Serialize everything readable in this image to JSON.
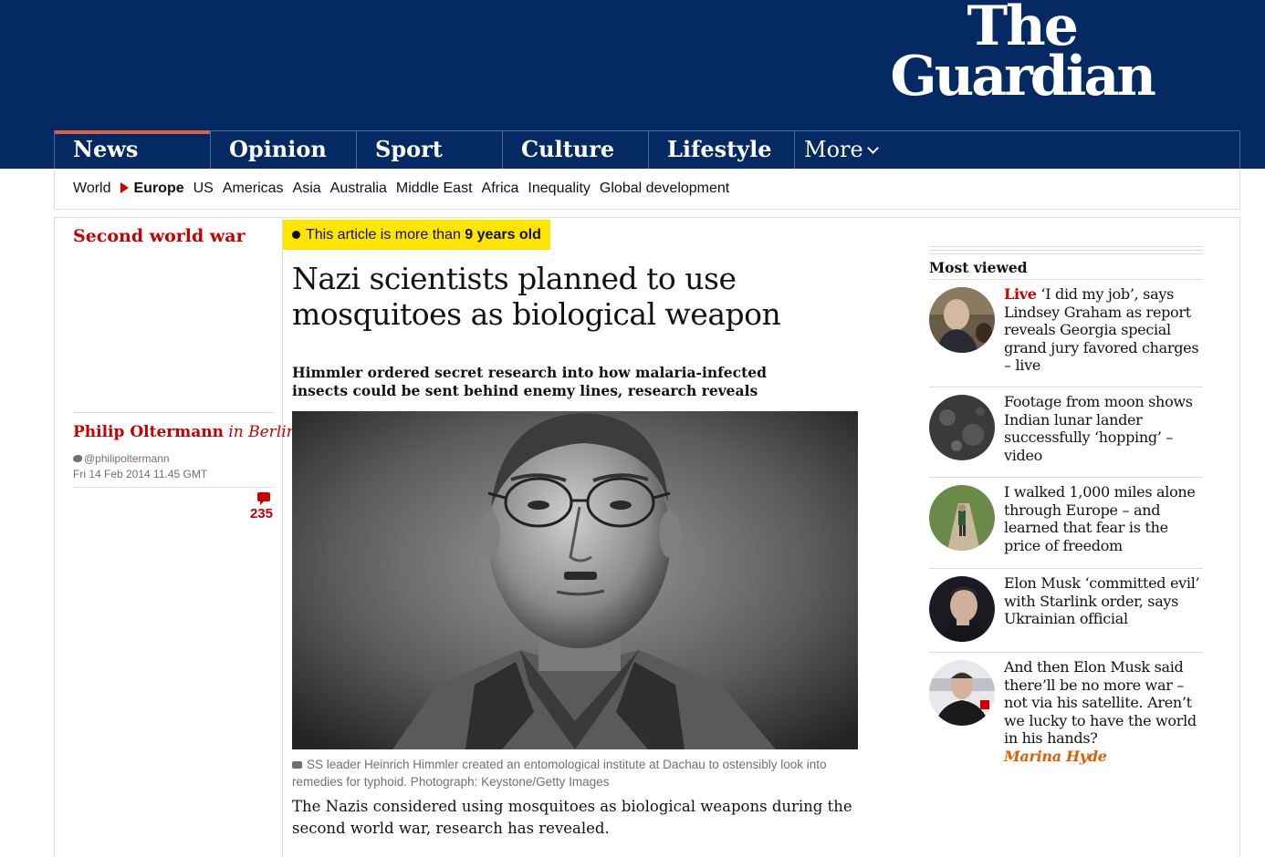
{
  "header": {
    "logo_line1": "The",
    "logo_line2": "Guardian",
    "pillars": [
      "News",
      "Opinion",
      "Sport",
      "Culture",
      "Lifestyle"
    ],
    "more_label": "More",
    "active_pillar": "News"
  },
  "subnav": {
    "items": [
      "World",
      "Europe",
      "US",
      "Americas",
      "Asia",
      "Australia",
      "Middle East",
      "Africa",
      "Inequality",
      "Global development"
    ],
    "current": "Europe"
  },
  "article": {
    "section": "Second world war",
    "age_warning_prefix": "This article is more than",
    "age_warning_age": "9 years old",
    "headline": "Nazi scientists planned to use mosquitoes as biological weapon",
    "standfirst": "Himmler ordered secret research into how malaria-infected insects could be sent behind enemy lines, research reveals",
    "author": "Philip Oltermann",
    "location": "in Berlin",
    "twitter": "@philipoltermann",
    "date": "Fri 14 Feb 2014 11.45 GMT",
    "comment_count": "235",
    "caption": "SS leader Heinrich Himmler created an entomological institute at Dachau to ostensibly look into remedies for typhoid. Photograph: Keystone/Getty Images",
    "body_first": "The Nazis considered using mosquitoes as biological weapons during the second world war, research has revealed."
  },
  "most_viewed": {
    "title": "Most viewed",
    "items": [
      {
        "live": "Live",
        "text": "‘I did my job’, says Lindsey Graham as report reveals Georgia special grand jury favored charges – live",
        "author": ""
      },
      {
        "live": "",
        "text": "Footage from moon shows Indian lunar lander successfully ‘hopping’ – video",
        "author": ""
      },
      {
        "live": "",
        "text": "I walked 1,000 miles alone through Europe – and learned that fear is the price of freedom",
        "author": ""
      },
      {
        "live": "",
        "text": "Elon Musk ‘committed evil’ with Starlink order, says Ukrainian official",
        "author": ""
      },
      {
        "live": "",
        "text": "And then Elon Musk said there’ll be no more war – not via his satellite. Aren’t we lucky to have the world in his hands?",
        "author": "Marina Hyde"
      }
    ]
  },
  "colors": {
    "brand": "#052962",
    "news_red": "#c70000",
    "warning_yellow": "#ffe500",
    "opinion_orange": "#e05e00"
  }
}
